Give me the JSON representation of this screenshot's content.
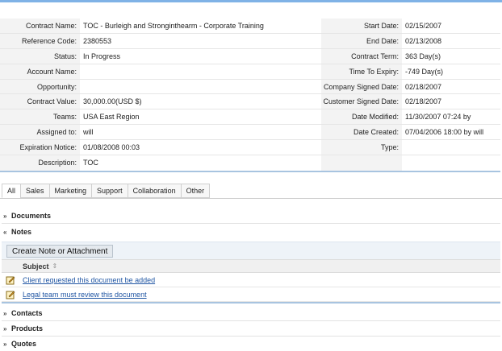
{
  "details": [
    {
      "l1": "Contract Name:",
      "v1": "TOC - Burleigh and Stronginthearm - Corporate Training",
      "l2": "Start Date:",
      "v2": "02/15/2007"
    },
    {
      "l1": "Reference Code:",
      "v1": "2380553",
      "l2": "End Date:",
      "v2": "02/13/2008"
    },
    {
      "l1": "Status:",
      "v1": "In Progress",
      "l2": "Contract Term:",
      "v2": "363 Day(s)"
    },
    {
      "l1": "Account Name:",
      "v1": "",
      "l2": "Time To Expiry:",
      "v2": "-749 Day(s)"
    },
    {
      "l1": "Opportunity:",
      "v1": "",
      "l2": "Company Signed Date:",
      "v2": "02/18/2007"
    },
    {
      "l1": "Contract Value:",
      "v1": "30,000.00(USD $)",
      "l2": "Customer Signed Date:",
      "v2": "02/18/2007"
    },
    {
      "l1": "Teams:",
      "v1": "USA East Region",
      "l2": "Date Modified:",
      "v2": "11/30/2007 07:24 by"
    },
    {
      "l1": "Assigned to:",
      "v1": "will",
      "l2": "Date Created:",
      "v2": "07/04/2006 18:00 by will"
    },
    {
      "l1": "Expiration Notice:",
      "v1": "01/08/2008 00:03",
      "l2": "Type:",
      "v2": ""
    },
    {
      "l1": "Description:",
      "v1": "TOC",
      "l2": "",
      "v2": ""
    }
  ],
  "tabs": [
    "All",
    "Sales",
    "Marketing",
    "Support",
    "Collaboration",
    "Other"
  ],
  "panels": {
    "documents": "Documents",
    "notes": "Notes",
    "contacts": "Contacts",
    "products": "Products",
    "quotes": "Quotes"
  },
  "notes": {
    "button": "Create Note or Attachment",
    "column": "Subject",
    "rows": [
      "Client requested this document be added",
      "Legal team must review this document"
    ]
  },
  "icons": {
    "expand": "chevron-double-down-icon",
    "collapse": "chevron-double-up-icon",
    "edit": "edit-note-icon",
    "sort": "sort-icon"
  }
}
